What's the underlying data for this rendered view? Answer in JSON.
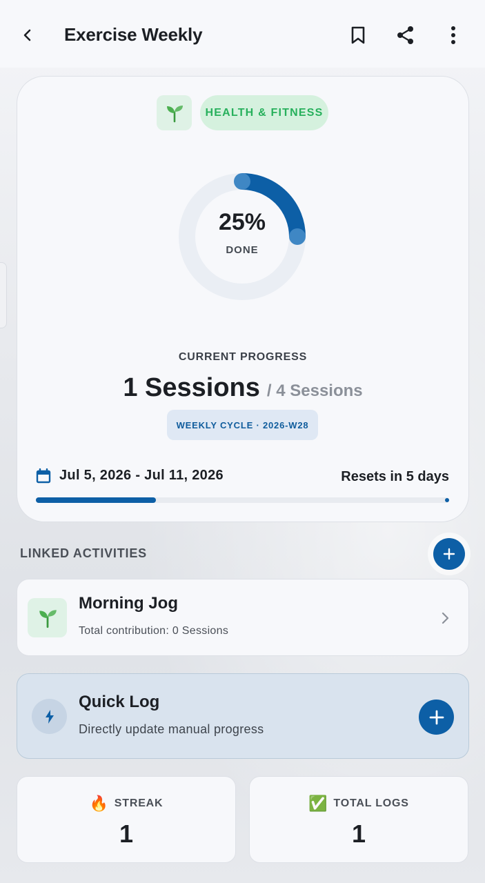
{
  "header": {
    "title": "Exercise Weekly",
    "back_icon": "chevron-left-icon",
    "bookmark_icon": "bookmark-icon",
    "share_icon": "share-icon",
    "more_icon": "more-vertical-icon"
  },
  "goal": {
    "category_icon": "seedling-icon",
    "category_label": "HEALTH & FITNESS",
    "progress": {
      "percent_text": "25%",
      "done_label": "DONE",
      "fraction": 0.25
    },
    "current_progress_label": "CURRENT PROGRESS",
    "sessions_done": "1 Sessions",
    "sessions_total": "/ 4 Sessions",
    "cycle_badge": "WEEKLY CYCLE · 2026-W28",
    "date_range": "Jul 5, 2026 - Jul 11, 2026",
    "resets_text": "Resets in 5 days",
    "period_elapsed_fraction": 0.29
  },
  "linked": {
    "section_title": "LINKED ACTIVITIES",
    "items": [
      {
        "name": "Morning Jog",
        "subtitle": "Total contribution: 0 Sessions",
        "icon": "seedling-icon"
      }
    ]
  },
  "quick_log": {
    "title": "Quick Log",
    "subtitle": "Directly update manual progress",
    "icon": "bolt-icon"
  },
  "stats": [
    {
      "emoji": "🔥",
      "label": "STREAK",
      "value": "1"
    },
    {
      "emoji": "✅",
      "label": "TOTAL LOGS",
      "value": "1"
    }
  ],
  "colors": {
    "accent": "#0d5fa6",
    "category_green": "#27b05c",
    "category_bg": "#d5f1de"
  }
}
